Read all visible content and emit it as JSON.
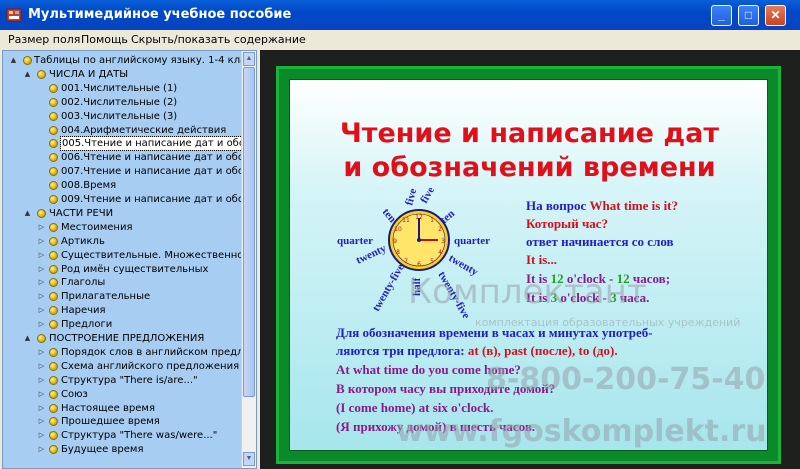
{
  "window": {
    "title": "Мультимедийное учебное пособие",
    "minimize": "_",
    "maximize": "□",
    "close": "✕"
  },
  "menu": [
    "Размер поля",
    "Помощь",
    "Скрыть/показать содержание"
  ],
  "tree": [
    {
      "label": "Таблицы по английскому языку. 1-4 классы",
      "level": 0,
      "expander": "▲"
    },
    {
      "label": "ЧИСЛА И ДАТЫ",
      "level": 1,
      "expander": "▲"
    },
    {
      "label": "001.Числительные (1)",
      "level": 2
    },
    {
      "label": "002.Числительные (2)",
      "level": 2
    },
    {
      "label": "003.Числительные (3)",
      "level": 2
    },
    {
      "label": "004.Арифметические действия",
      "level": 2
    },
    {
      "label": "005.Чтение и написание дат и обозна",
      "level": 2,
      "selected": true
    },
    {
      "label": "006.Чтение и написание дат и обозна",
      "level": 2
    },
    {
      "label": "007.Чтение и написание дат и обозна",
      "level": 2
    },
    {
      "label": "008.Время",
      "level": 2
    },
    {
      "label": "009.Чтение и написание дат и обозна",
      "level": 2
    },
    {
      "label": "ЧАСТИ РЕЧИ",
      "level": 1,
      "expander": "▲"
    },
    {
      "label": "Местоимения",
      "level": 2,
      "expander": "▷"
    },
    {
      "label": "Артикль",
      "level": 2,
      "expander": "▷"
    },
    {
      "label": "Существительные. Множественное ч",
      "level": 2,
      "expander": "▷"
    },
    {
      "label": "Род имён существительных",
      "level": 2,
      "expander": "▷"
    },
    {
      "label": "Глаголы",
      "level": 2,
      "expander": "▷"
    },
    {
      "label": "Прилагательные",
      "level": 2,
      "expander": "▷"
    },
    {
      "label": "Наречия",
      "level": 2,
      "expander": "▷"
    },
    {
      "label": "Предлоги",
      "level": 2,
      "expander": "▷"
    },
    {
      "label": "ПОСТРОЕНИЕ ПРЕДЛОЖЕНИЯ",
      "level": 1,
      "expander": "▲"
    },
    {
      "label": "Порядок слов в английском предлож",
      "level": 2,
      "expander": "▷"
    },
    {
      "label": "Схема английского предложения",
      "level": 2,
      "expander": "▷"
    },
    {
      "label": "Структура \"There is/are...\"",
      "level": 2,
      "expander": "▷"
    },
    {
      "label": "Союз",
      "level": 2,
      "expander": "▷"
    },
    {
      "label": "Настоящее время",
      "level": 2,
      "expander": "▷"
    },
    {
      "label": "Прошедшее время",
      "level": 2,
      "expander": "▷"
    },
    {
      "label": "Структура \"There was/were...\"",
      "level": 2,
      "expander": "▷"
    },
    {
      "label": "Будущее время",
      "level": 2,
      "expander": "▷"
    }
  ],
  "slide": {
    "title_line1": "Чтение и написание дат",
    "title_line2": "и обозначений времени",
    "clock_words": {
      "five_top_left": "five",
      "five_top_right": "five",
      "ten_left": "ten",
      "ten_right": "ten",
      "quarter_left": "quarter",
      "quarter_right": "quarter",
      "twenty_left": "twenty",
      "twenty_right": "twenty",
      "twenty_five_left": "twenty-five",
      "twenty_five_right": "twenty-five",
      "half": "half"
    },
    "q1_a": "На вопрос",
    "q1_b": "What time is it?",
    "q2": "Который час?",
    "q3": "ответ начинается со слов",
    "q4": "It is...",
    "ex1_a": "It is",
    "ex1_b": "12",
    "ex1_c": "o'clock -",
    "ex1_d": "12",
    "ex1_e": "часов;",
    "ex2_a": "It is",
    "ex2_b": "3",
    "ex2_c": "o'clock -",
    "ex2_d": "3",
    "ex2_e": "часа.",
    "p1": "Для обозначения времени в часах и минутах  употреб-",
    "p2_a": "ляются три предлога:",
    "p2_b": "at (в),",
    "p2_c": "past (после),",
    "p2_d": "to (до).",
    "l1": "At what time do you come home?",
    "l2": "В котором часу вы приходите домой?",
    "l3": "(I come home) at six o'clock.",
    "l4": "(Я прихожу домой) в шесть часов."
  },
  "watermark": {
    "brand": "Комплектант",
    "tagline": "комплектация образовательных учреждений",
    "phone": "8-800-200-75-40",
    "site": "www.fgoskomplekt.ru"
  },
  "colors": {
    "title_red": "#e0101a",
    "text_blue": "#2020c0",
    "green_frame": "#0b8a2a"
  }
}
